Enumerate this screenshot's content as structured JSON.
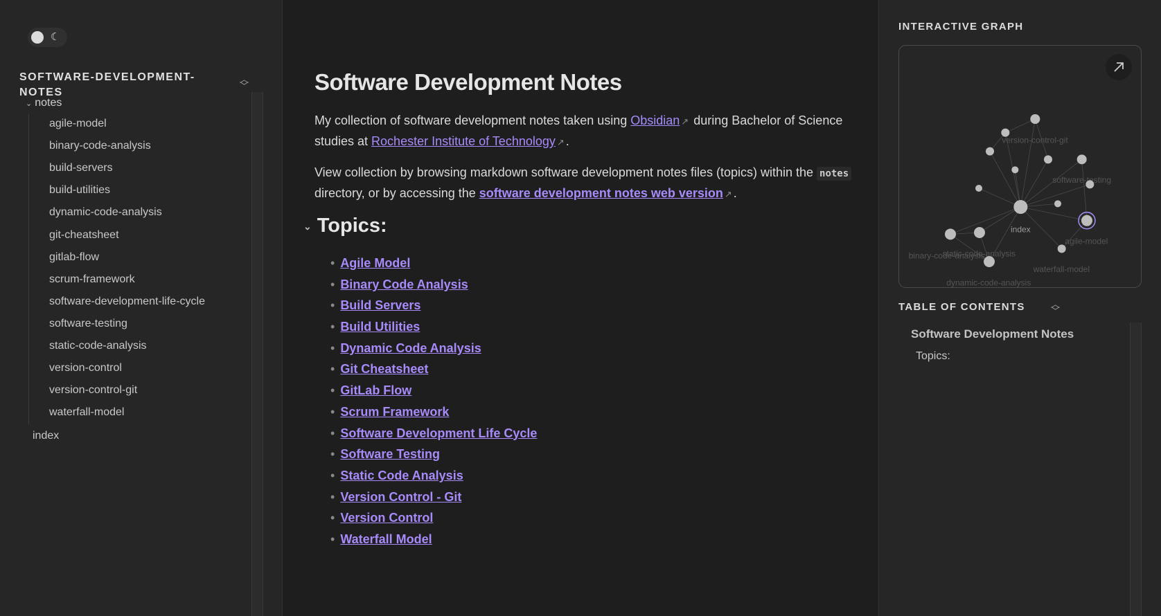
{
  "sidebar": {
    "theme_toggle": {
      "icon": "moon-icon"
    },
    "explorer_title": "SOFTWARE-DEVELOPMENT-NOTES",
    "folder": "notes",
    "items": [
      "agile-model",
      "binary-code-analysis",
      "build-servers",
      "build-utilities",
      "dynamic-code-analysis",
      "git-cheatsheet",
      "gitlab-flow",
      "scrum-framework",
      "software-development-life-cycle",
      "software-testing",
      "static-code-analysis",
      "version-control",
      "version-control-git",
      "waterfall-model"
    ],
    "root_item": "index"
  },
  "main": {
    "title": "Software Development Notes",
    "p1": {
      "a": "My collection of software development notes taken using ",
      "link1": "Obsidian",
      "b": " during Bachelor of Science studies at ",
      "link2": "Rochester Institute of Technology",
      "c": "."
    },
    "p2": {
      "a": "View collection by browsing markdown software development notes files (topics) within the ",
      "code": "notes",
      "b": " directory, or by accessing the ",
      "link": "software development notes web version",
      "c": "."
    },
    "topics_heading": "Topics:",
    "topics": [
      "Agile Model",
      "Binary Code Analysis",
      "Build Servers",
      "Build Utilities",
      "Dynamic Code Analysis",
      "Git Cheatsheet",
      "GitLab Flow",
      "Scrum Framework",
      "Software Development Life Cycle",
      "Software Testing",
      "Static Code Analysis",
      "Version Control - Git",
      "Version Control",
      "Waterfall Model"
    ]
  },
  "right": {
    "graph_title": "INTERACTIVE GRAPH",
    "graph_labels": {
      "index": "index",
      "vcg": "version-control-git",
      "st": "software-testing",
      "agile": "agile-model",
      "sca": "static-code-analysis",
      "bca": "binary-code-analysis",
      "wf": "waterfall-model",
      "dca": "dynamic-code-analysis"
    },
    "toc_title": "TABLE OF CONTENTS",
    "toc": [
      "Software Development Notes",
      "Topics:"
    ]
  },
  "colors": {
    "accent": "#a88bfa",
    "bg": "#1e1e1e",
    "sidebar": "#262626"
  }
}
